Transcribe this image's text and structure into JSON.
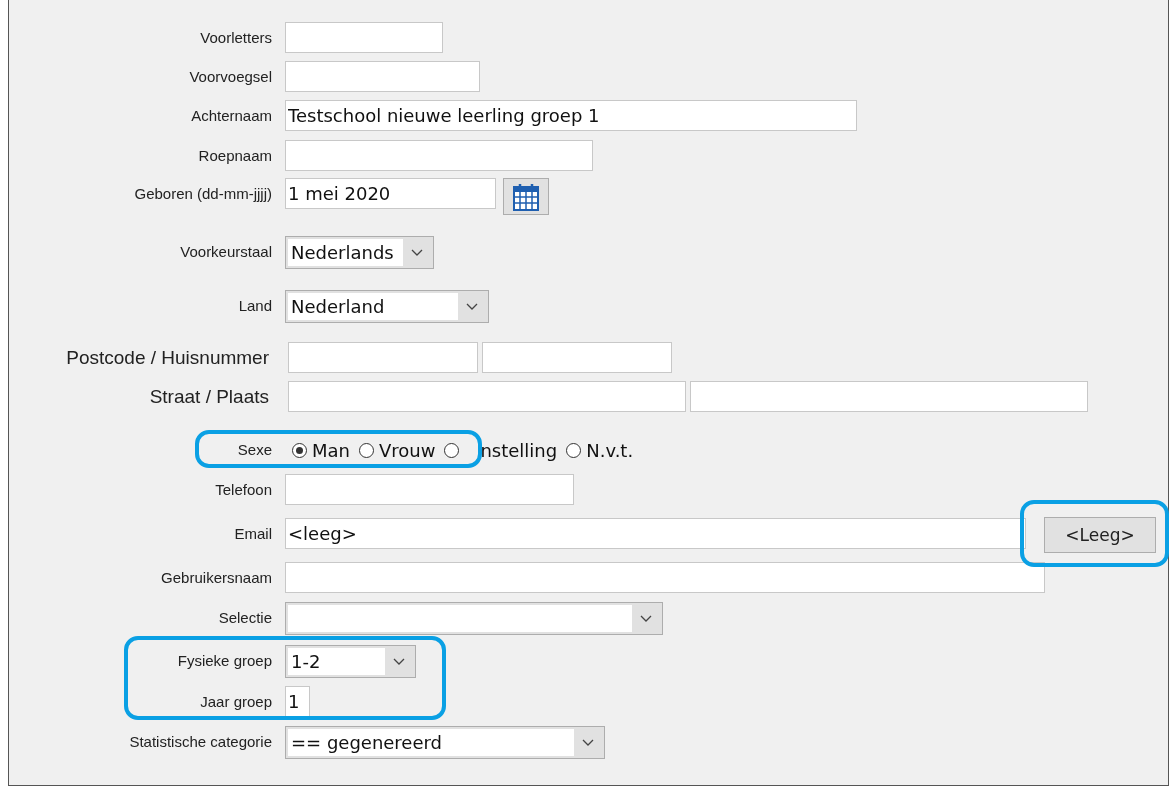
{
  "rows": [
    {
      "kind": "text",
      "label": "Voorletters"
    },
    {
      "kind": "text",
      "label": "Voorvoegsel"
    },
    {
      "kind": "text",
      "label": "Achternaam",
      "value": "Testschool nieuwe leerling groep 1"
    },
    {
      "kind": "text",
      "label": "Roepnaam"
    },
    {
      "kind": "date",
      "label": "Geboren (dd-mm-jjjj)",
      "value": "1 mei 2020"
    },
    {
      "kind": "select",
      "label": "Voorkeurstaal",
      "value": "Nederlands"
    },
    {
      "kind": "select",
      "label": "Land",
      "value": "Nederland"
    },
    {
      "kind": "pair",
      "label": "Postcode / Huisnummer"
    },
    {
      "kind": "pair",
      "label": "Straat / Plaats"
    },
    {
      "kind": "radio",
      "label": "Sexe",
      "options": [
        {
          "label": "Man",
          "selected": true
        },
        {
          "label": "Vrouw",
          "selected": false
        },
        {
          "label": "nstelling",
          "selected": false
        },
        {
          "label": "N.v.t.",
          "selected": false
        }
      ]
    },
    {
      "kind": "text",
      "label": "Telefoon"
    },
    {
      "kind": "email",
      "label": "Email",
      "value": "<leeg>",
      "button": "<Leeg>"
    },
    {
      "kind": "text",
      "label": "Gebruikersnaam"
    },
    {
      "kind": "select",
      "label": "Selectie"
    },
    {
      "kind": "select",
      "label": "Fysieke groep",
      "value": "1-2"
    },
    {
      "kind": "text",
      "label": "Jaar groep",
      "value": "1"
    },
    {
      "kind": "select",
      "label": "Statistische categorie",
      "value": "== gegenereerd"
    }
  ]
}
